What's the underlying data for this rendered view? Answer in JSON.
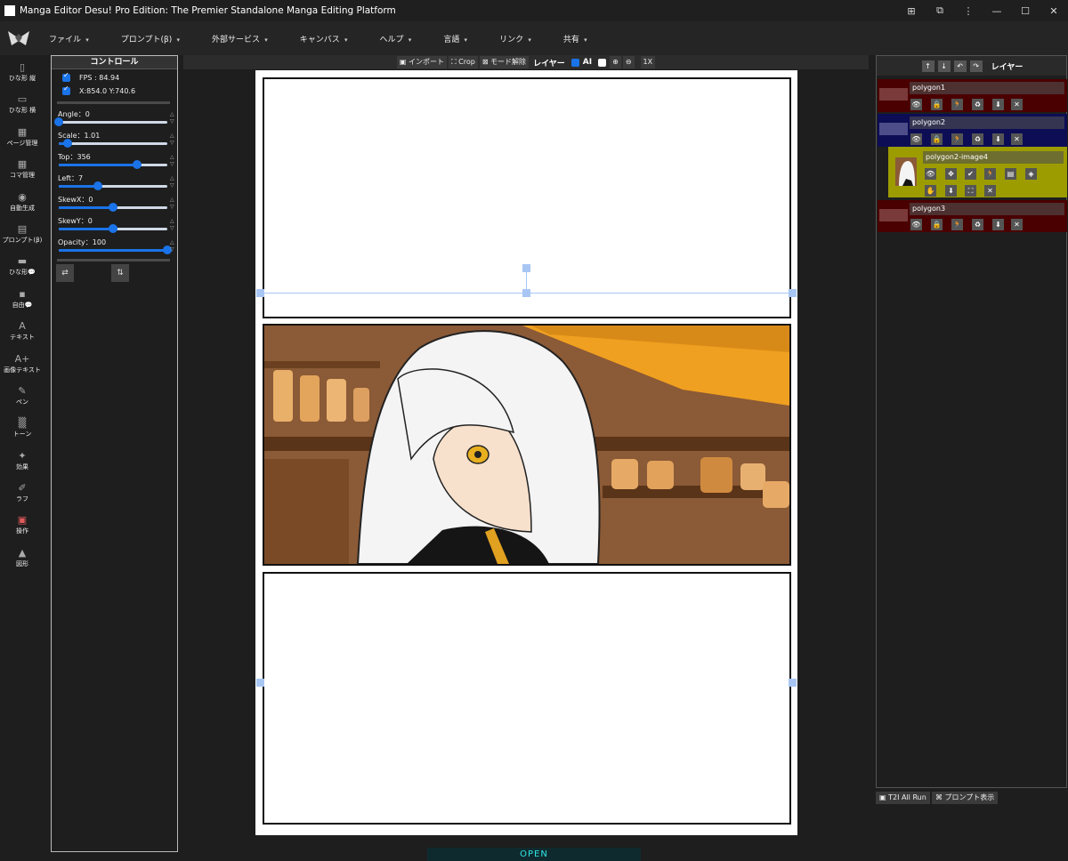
{
  "window": {
    "title": "Manga Editor Desu! Pro Edition: The Premier Standalone Manga Editing Platform",
    "controls": [
      "⊞",
      "⧉",
      "⋮",
      "—",
      "☐",
      "✕"
    ]
  },
  "menu": [
    "ファイル",
    "プロンプト(β)",
    "外部サービス",
    "キャンバス",
    "ヘルプ",
    "言語",
    "リンク",
    "共有"
  ],
  "tools": [
    {
      "icon": "▯",
      "label": "ひな形 縦"
    },
    {
      "icon": "▭",
      "label": "ひな形 横"
    },
    {
      "icon": "▦",
      "label": "ページ管理"
    },
    {
      "icon": "▦",
      "label": "コマ管理"
    },
    {
      "icon": "◉",
      "label": "自動生成"
    },
    {
      "icon": "▤",
      "label": "プロンプト(β)"
    },
    {
      "icon": "▬",
      "label": "ひな形💬"
    },
    {
      "icon": "▪",
      "label": "自由💬"
    },
    {
      "icon": "A",
      "label": "テキスト"
    },
    {
      "icon": "A+",
      "label": "画像テキスト"
    },
    {
      "icon": "✎",
      "label": "ペン"
    },
    {
      "icon": "▒",
      "label": "トーン"
    },
    {
      "icon": "✦",
      "label": "効果"
    },
    {
      "icon": "✐",
      "label": "ラフ"
    },
    {
      "icon": "▣",
      "label": "操作"
    },
    {
      "icon": "▲",
      "label": "図形"
    }
  ],
  "control": {
    "title": "コントロール",
    "fps": "FPS : 84.94",
    "coords": "X:854.0 Y:740.6",
    "sliders": [
      {
        "label": "Angle：0",
        "level": 0.0
      },
      {
        "label": "Scale：1.01",
        "level": 0.08
      },
      {
        "label": "Top：356",
        "level": 0.72
      },
      {
        "label": "Left：7",
        "level": 0.36
      },
      {
        "label": "SkewX：0",
        "level": 0.5
      },
      {
        "label": "SkewY：0",
        "level": 0.5
      },
      {
        "label": "Opacity：100",
        "level": 1.0
      }
    ],
    "btn_swap_h": "⇄",
    "btn_swap_v": "⇅"
  },
  "toolbar": {
    "import": "インポート",
    "crop": "Crop",
    "mode_off": "モード解除",
    "layer": "レイヤー",
    "ai": "AI",
    "zoom_in": "⊕",
    "zoom_out": "⊖",
    "one_x": "1X"
  },
  "layers_panel": {
    "title": "レイヤー",
    "head_buttons": [
      "↑",
      "↓",
      "↶",
      "↷"
    ],
    "layers": [
      {
        "name": "polygon1",
        "bg": "#4a0000",
        "swatch": "#7a3a3a"
      },
      {
        "name": "polygon2",
        "bg": "#0d0d55",
        "swatch": "#4d4d8a"
      },
      {
        "name": "polygon2-image4",
        "bg": "#9c9c00"
      },
      {
        "name": "polygon3",
        "bg": "#4a0000",
        "swatch": "#7a3a3a"
      }
    ],
    "row_icons": [
      "👁",
      "🔒",
      "🏃",
      "♻",
      "⬇",
      "✕"
    ],
    "image_icons_row1": [
      "👁",
      "✥",
      "✔",
      "🏃",
      "▤",
      "◈"
    ],
    "image_icons_row2": [
      "✋",
      "⬇",
      "⛶",
      "✕"
    ]
  },
  "bottom": {
    "t2i": "T2I All Run",
    "prompt_show": "プロンプト表示",
    "open": "OPEN"
  }
}
